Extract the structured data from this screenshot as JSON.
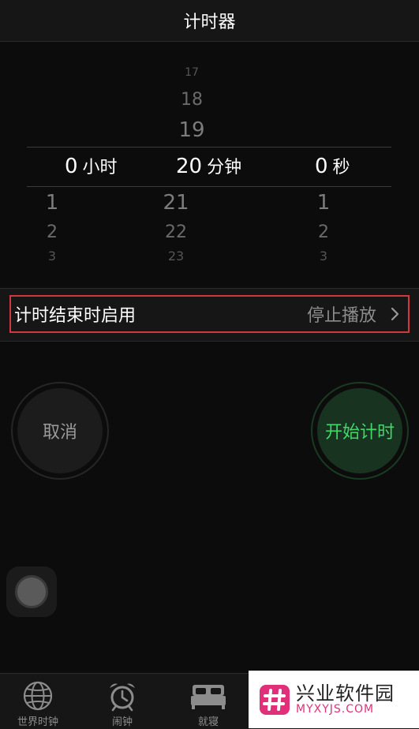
{
  "header": {
    "title": "计时器"
  },
  "picker": {
    "hours": {
      "above": [],
      "selected": "0",
      "unit": "小时",
      "below": [
        "1",
        "2",
        "3"
      ]
    },
    "minutes": {
      "above": [
        "17",
        "18",
        "19"
      ],
      "selected": "20",
      "unit": "分钟",
      "below": [
        "21",
        "22",
        "23"
      ]
    },
    "seconds": {
      "above": [],
      "selected": "0",
      "unit": "秒",
      "below": [
        "1",
        "2",
        "3"
      ]
    }
  },
  "setting": {
    "label": "计时结束时启用",
    "value": "停止播放"
  },
  "buttons": {
    "cancel": "取消",
    "start": "开始计时"
  },
  "tabs": [
    {
      "label": "世界时钟",
      "icon": "globe-icon"
    },
    {
      "label": "闹钟",
      "icon": "alarm-clock-icon"
    },
    {
      "label": "就寝",
      "icon": "bed-icon"
    }
  ],
  "watermark": {
    "name": "兴业软件园",
    "domain": "MYXYJS.COM",
    "icon": "hash-logo"
  },
  "colors": {
    "start_green": "#45d66a",
    "highlight_red": "#d2373c"
  }
}
